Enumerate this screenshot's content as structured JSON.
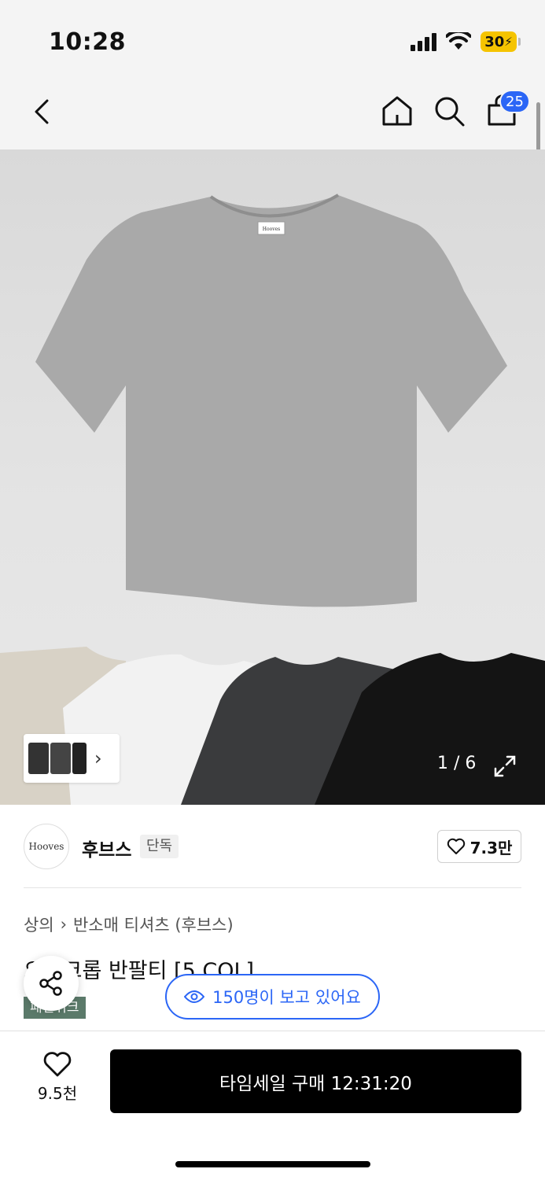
{
  "status_bar": {
    "time": "10:28",
    "battery": "30",
    "icons": [
      "signal-icon",
      "wifi-icon",
      "battery-icon"
    ]
  },
  "nav": {
    "icons": [
      "back-icon",
      "home-icon",
      "search-icon",
      "cart-icon"
    ],
    "cart_count": "25"
  },
  "gallery": {
    "counter": "1 / 6",
    "icons": [
      "chevron-right-icon",
      "expand-icon"
    ],
    "shirt_colors": [
      "#a9a9a9",
      "#d8d2c6",
      "#f2f2f2",
      "#3a3b3d",
      "#141414"
    ],
    "product_label": "Hooves"
  },
  "brand": {
    "logo_text": "Hooves",
    "name": "후브스",
    "badge": "단독",
    "likes": "7.3만"
  },
  "breadcrumb": {
    "items": [
      "상의",
      "반소매 티셔츠 (후브스)"
    ]
  },
  "product": {
    "title": "오버크롭 반팔티 [5 COL]",
    "tag": "패션위크"
  },
  "viewers": {
    "label": "150명이 보고 있어요"
  },
  "bottom_bar": {
    "wish_count": "9.5천",
    "buy_label": "타임세일 구매 12:31:20"
  },
  "colors": {
    "accent_blue": "#2b66f6",
    "tag_green": "#5b7a6a",
    "buy_black": "#000000"
  }
}
